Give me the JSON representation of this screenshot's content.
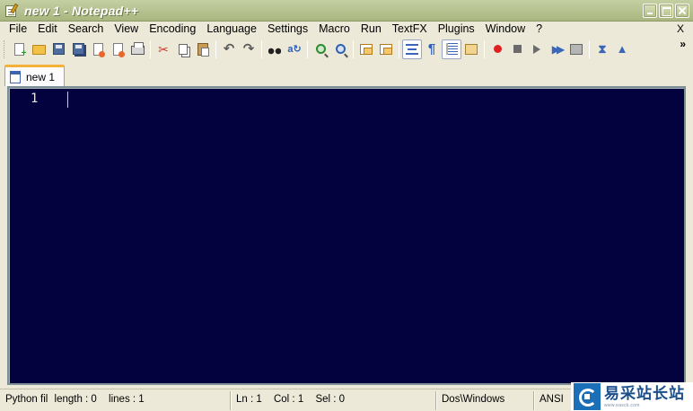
{
  "window": {
    "title": "new  1 - Notepad++"
  },
  "menubar": {
    "items": [
      "File",
      "Edit",
      "Search",
      "View",
      "Encoding",
      "Language",
      "Settings",
      "Macro",
      "Run",
      "TextFX",
      "Plugins",
      "Window",
      "?"
    ],
    "close_label": "X"
  },
  "toolbar": {
    "chevron": "»",
    "icons": [
      "new-file-icon",
      "open-file-icon",
      "save-icon",
      "save-all-icon",
      "close-icon",
      "close-all-icon",
      "print-icon",
      "cut-icon",
      "copy-icon",
      "paste-icon",
      "undo-icon",
      "redo-icon",
      "find-icon",
      "replace-icon",
      "zoom-in-icon",
      "zoom-out-icon",
      "sync-vertical-icon",
      "sync-horizontal-icon",
      "word-wrap-icon",
      "show-all-chars-icon",
      "indent-guide-icon",
      "user-language-icon",
      "record-macro-icon",
      "stop-macro-icon",
      "play-macro-icon",
      "run-macro-multiple-icon",
      "save-macro-icon",
      "fold-all-icon",
      "unfold-icon"
    ]
  },
  "tabs": [
    {
      "label": "new  1",
      "active": true
    }
  ],
  "editor": {
    "line_numbers": [
      "1"
    ],
    "background": "#03013e",
    "line_number_color": "#e6e6e6",
    "caret_color": "#e5d067"
  },
  "statusbar": {
    "file_type": "Python fil",
    "length": "length : 0",
    "lines": "lines : 1",
    "ln": "Ln : 1",
    "col": "Col : 1",
    "sel": "Sel : 0",
    "eol": "Dos\\Windows",
    "encoding": "ANSI"
  },
  "watermark": {
    "text": "易采站长站",
    "sub": "www.easck.com"
  },
  "colors": {
    "titlebar": "#b2bd8a",
    "tab_accent": "#f4b23b",
    "chrome": "#ece9d8"
  }
}
